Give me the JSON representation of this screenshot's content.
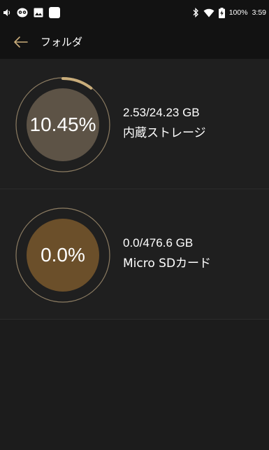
{
  "status_bar": {
    "battery_text": "100%",
    "time": "3:59",
    "icons": [
      "volume-icon",
      "owl-app-icon",
      "image-icon",
      "app-square-icon",
      "bluetooth-icon",
      "wifi-icon",
      "battery-charging-icon"
    ]
  },
  "app_bar": {
    "title": "フォルダ",
    "back_icon": "back-arrow-icon"
  },
  "storages": [
    {
      "percent_text": "10.45%",
      "used_fraction": 0.1045,
      "capacity": "2.53/24.23 GB",
      "name": "内蔵ストレージ",
      "inner_color": "#5d5346"
    },
    {
      "percent_text": "0.0%",
      "used_fraction": 0.0,
      "capacity": "0.0/476.6 GB",
      "name": "Micro SDカード",
      "inner_color": "#6b4f2a"
    }
  ],
  "colors": {
    "accent_gold": "#c9ad7b",
    "ring_outline": "#8c7c62",
    "background": "#1c1c1c",
    "bar_background": "#121212"
  }
}
